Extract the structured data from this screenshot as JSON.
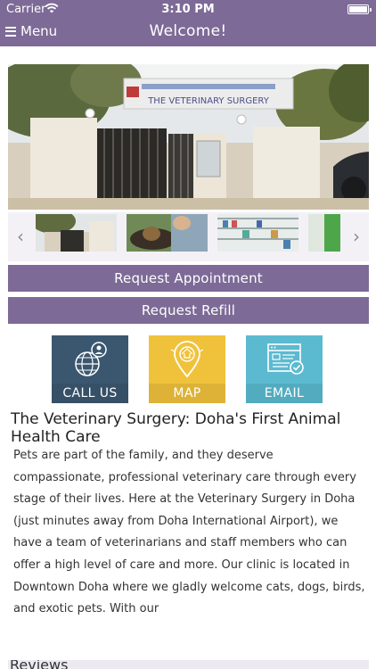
{
  "status_bar": {
    "carrier": "Carrier",
    "time": "3:10 PM"
  },
  "nav": {
    "menu_label": "Menu",
    "title": "Welcome!"
  },
  "hero": {
    "sign_text": "THE VETERINARY SURGERY"
  },
  "actions": {
    "request_appointment": "Request Appointment",
    "request_refill": "Request Refill"
  },
  "tiles": [
    {
      "label": "CALL US",
      "icon": "globe-phone-icon",
      "color": "#3b5770"
    },
    {
      "label": "MAP",
      "icon": "map-pin-icon",
      "color": "#f0c23c"
    },
    {
      "label": "EMAIL",
      "icon": "email-window-icon",
      "color": "#5bbad0"
    }
  ],
  "article": {
    "title": "The Veterinary Surgery: Doha's First Animal Health Care",
    "body": "Pets are part of the family, and they deserve compassionate, professional veterinary care through every stage of their lives. Here at the Veterinary Surgery in Doha (just minutes away from Doha International Airport), we have a team of veterinarians and staff members who can offer a high level of care and more. Our clinic is located in Downtown Doha where we gladly welcome cats, dogs, birds, and exotic pets. With our"
  },
  "next_section": {
    "label": "Reviews"
  },
  "theme": {
    "primary": "#7d6a97"
  }
}
